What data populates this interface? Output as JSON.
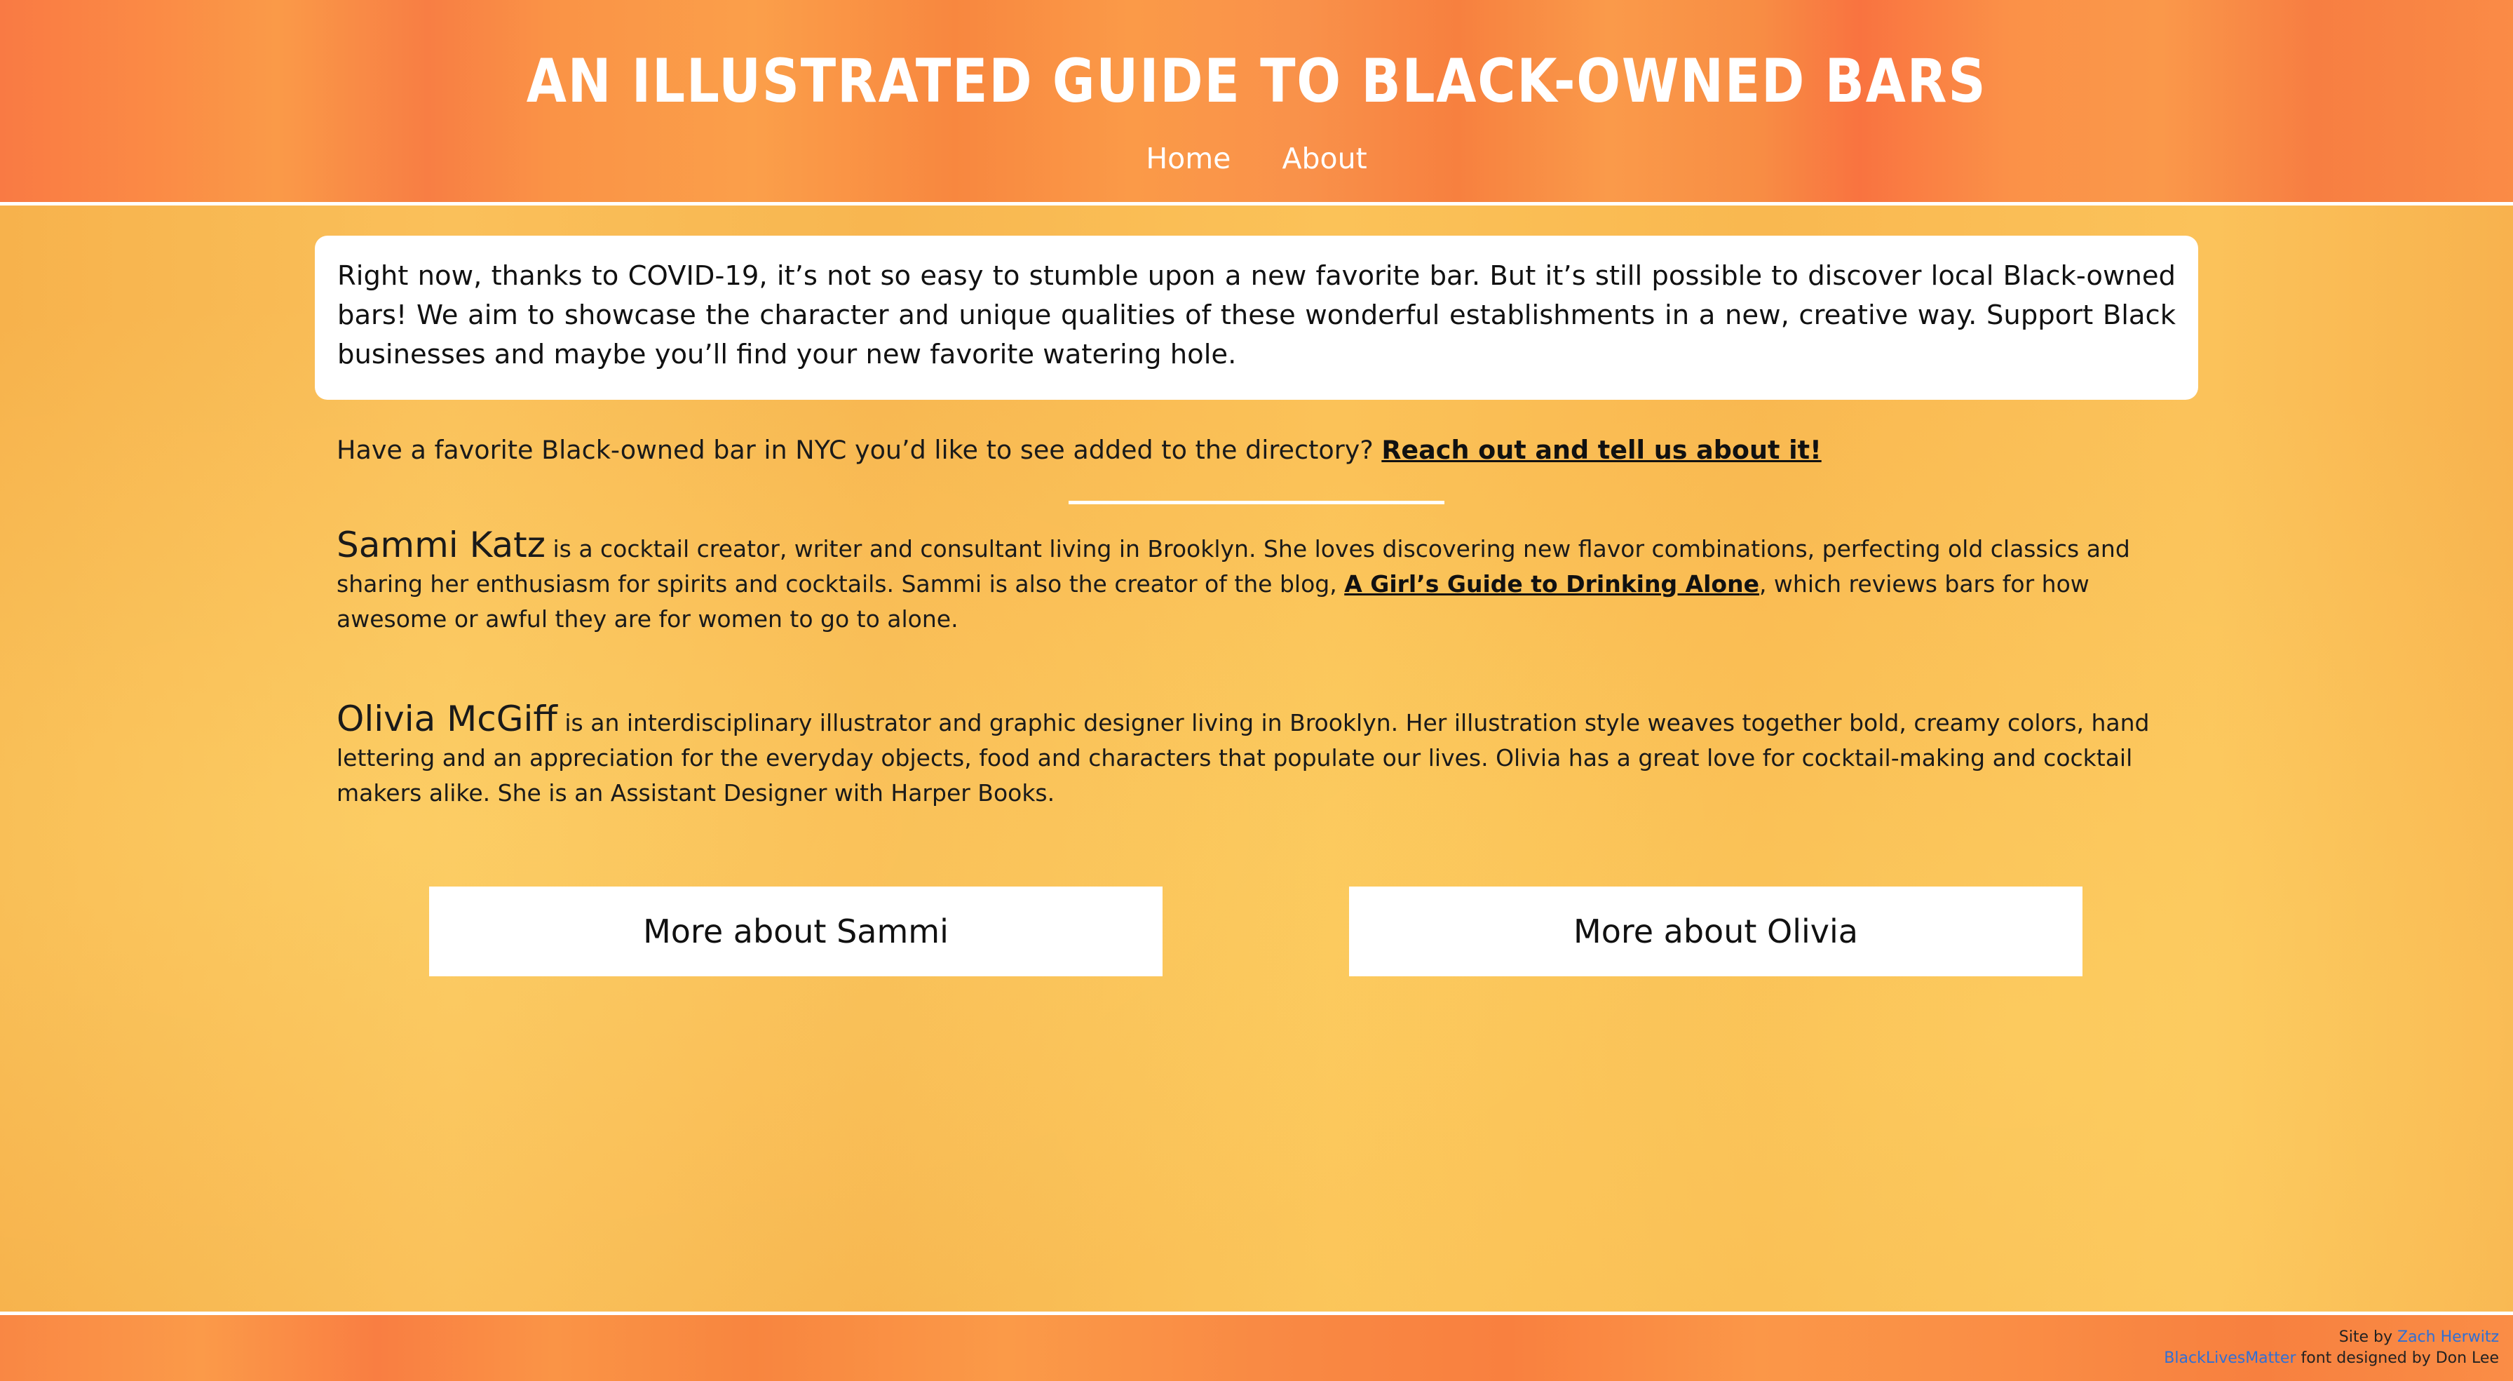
{
  "header": {
    "title": "AN ILLUSTRATED GUIDE TO BLACK-OWNED BARS",
    "nav": [
      {
        "label": "Home"
      },
      {
        "label": "About"
      }
    ]
  },
  "intro": {
    "text": "Right now, thanks to COVID-19, it’s not so easy to stumble upon a new favorite bar. But it’s still possible to discover local Black-owned bars! We aim to showcase the character and unique qualities of these wonderful establishments in a new, creative way. Support Black businesses and maybe you’ll find your new favorite watering hole."
  },
  "cta": {
    "text": "Have a favorite Black-owned bar in NYC you’d like to see added to the directory? ",
    "link": "Reach out and tell us about it!"
  },
  "bios": {
    "sammi": {
      "name": "Sammi Katz",
      "text_before": " is a cocktail creator, writer and consultant living in Brooklyn. She loves discovering new flavor combinations, perfecting old classics and sharing her enthusiasm for spirits and cocktails. Sammi is also the creator of the blog, ",
      "link": "A Girl’s Guide to Drinking Alone",
      "text_after": ", which reviews bars for how awesome or awful they are for women to go to alone."
    },
    "olivia": {
      "name": "Olivia McGiff",
      "text": " is an interdisciplinary illustrator and graphic designer living in Brooklyn. Her illustration style weaves together bold, creamy colors, hand lettering and an appreciation for the everyday objects, food and characters that populate our lives. Olivia has a great love for cocktail-making and cocktail makers alike. She is an Assistant Designer with Harper Books."
    }
  },
  "buttons": {
    "sammi": "More about Sammi",
    "olivia": "More about Olivia"
  },
  "footer": {
    "site_by_label": "Site by ",
    "site_by_name": "Zach Herwitz",
    "font_link": "BlackLivesMatter",
    "font_credit": " font designed by Don Lee"
  },
  "colors": {
    "header_orange": "#f98a44",
    "page_yellow": "#fab950",
    "link_blue": "#2f6fd6",
    "white": "#ffffff"
  }
}
